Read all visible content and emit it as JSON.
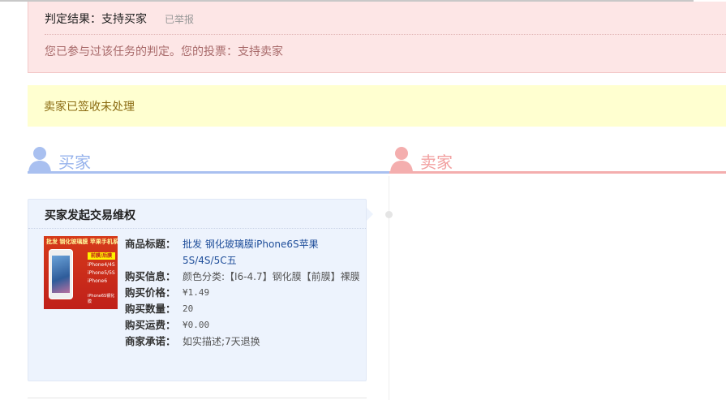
{
  "verdict": {
    "result_text": "判定结果：支持买家",
    "reported_text": "已举报",
    "vote_text": "您已参与过该任务的判定。您的投票：支持卖家"
  },
  "status": {
    "text": "卖家已签收未处理"
  },
  "roles": {
    "buyer_label": "买家",
    "seller_label": "卖家",
    "buyer_color": "#a9c0f0",
    "seller_color": "#f4aeae"
  },
  "card": {
    "title": "买家发起交易维权",
    "thumbnail": {
      "top_text": "批发 钢化玻璃膜 苹果手机系列",
      "tag1": "前膜/后膜",
      "tag2": "iPhone4/4S",
      "tag3": "iPhone5/5S",
      "tag4": "iPhone6",
      "foot_text": "iPhone6S钢化膜"
    },
    "rows": [
      {
        "key": "商品标题：",
        "value": "批发 钢化玻璃膜iPhone6S苹果5S/4S/5C五",
        "link": true
      },
      {
        "key": "购买信息：",
        "value": "颜色分类:【I6-4.7】钢化膜【前膜】裸膜",
        "link": false,
        "cn": true
      },
      {
        "key": "购买价格：",
        "value": "¥1.49",
        "link": false
      },
      {
        "key": "购买数量：",
        "value": "20",
        "link": false
      },
      {
        "key": "购买运费：",
        "value": "¥0.00",
        "link": false
      },
      {
        "key": "商家承诺：",
        "value": "如实描述;7天退换",
        "link": false,
        "cn": true
      }
    ]
  }
}
